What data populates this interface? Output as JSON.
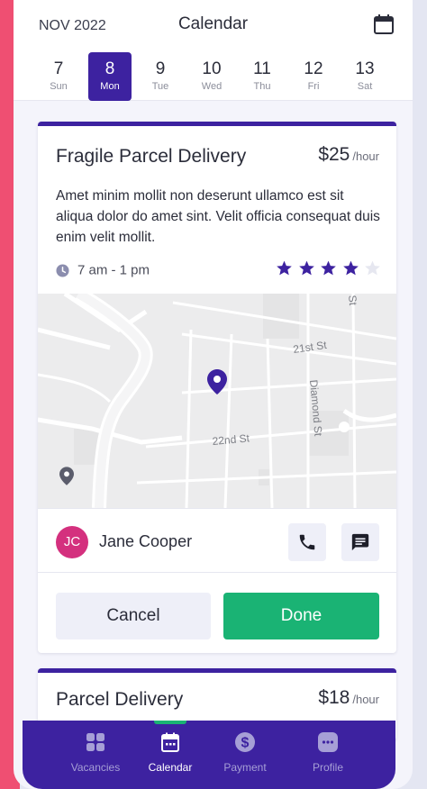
{
  "header": {
    "month": "NOV 2022",
    "title": "Calendar"
  },
  "days": [
    {
      "num": "7",
      "name": "Sun",
      "active": false
    },
    {
      "num": "8",
      "name": "Mon",
      "active": true
    },
    {
      "num": "9",
      "name": "Tue",
      "active": false
    },
    {
      "num": "10",
      "name": "Wed",
      "active": false
    },
    {
      "num": "11",
      "name": "Thu",
      "active": false
    },
    {
      "num": "12",
      "name": "Fri",
      "active": false
    },
    {
      "num": "13",
      "name": "Sat",
      "active": false
    }
  ],
  "job1": {
    "title": "Fragile Parcel Delivery",
    "price": "$25",
    "unit": "/hour",
    "description": "Amet minim mollit non deserunt ullamco est sit aliqua dolor do amet sint. Velit officia consequat duis enim velit mollit.",
    "time": "7 am - 1 pm",
    "rating": 4,
    "rating_max": 5,
    "map": {
      "street1": "21st St",
      "street2": "22nd St",
      "street3": "Diamond St",
      "street4": "St"
    },
    "contact": {
      "initials": "JC",
      "name": "Jane Cooper"
    },
    "cancel_label": "Cancel",
    "done_label": "Done"
  },
  "job2": {
    "title": "Parcel Delivery",
    "price": "$18",
    "unit": "/hour"
  },
  "nav": {
    "items": [
      {
        "label": "Vacancies",
        "icon": "grid-icon"
      },
      {
        "label": "Calendar",
        "icon": "calendar-icon"
      },
      {
        "label": "Payment",
        "icon": "dollar-icon"
      },
      {
        "label": "Profile",
        "icon": "chat-bubble-icon"
      }
    ],
    "active": "Calendar"
  },
  "colors": {
    "primary": "#3d22a0",
    "success": "#1ab374",
    "avatar": "#d4307e",
    "frame": "#ef4f72"
  }
}
